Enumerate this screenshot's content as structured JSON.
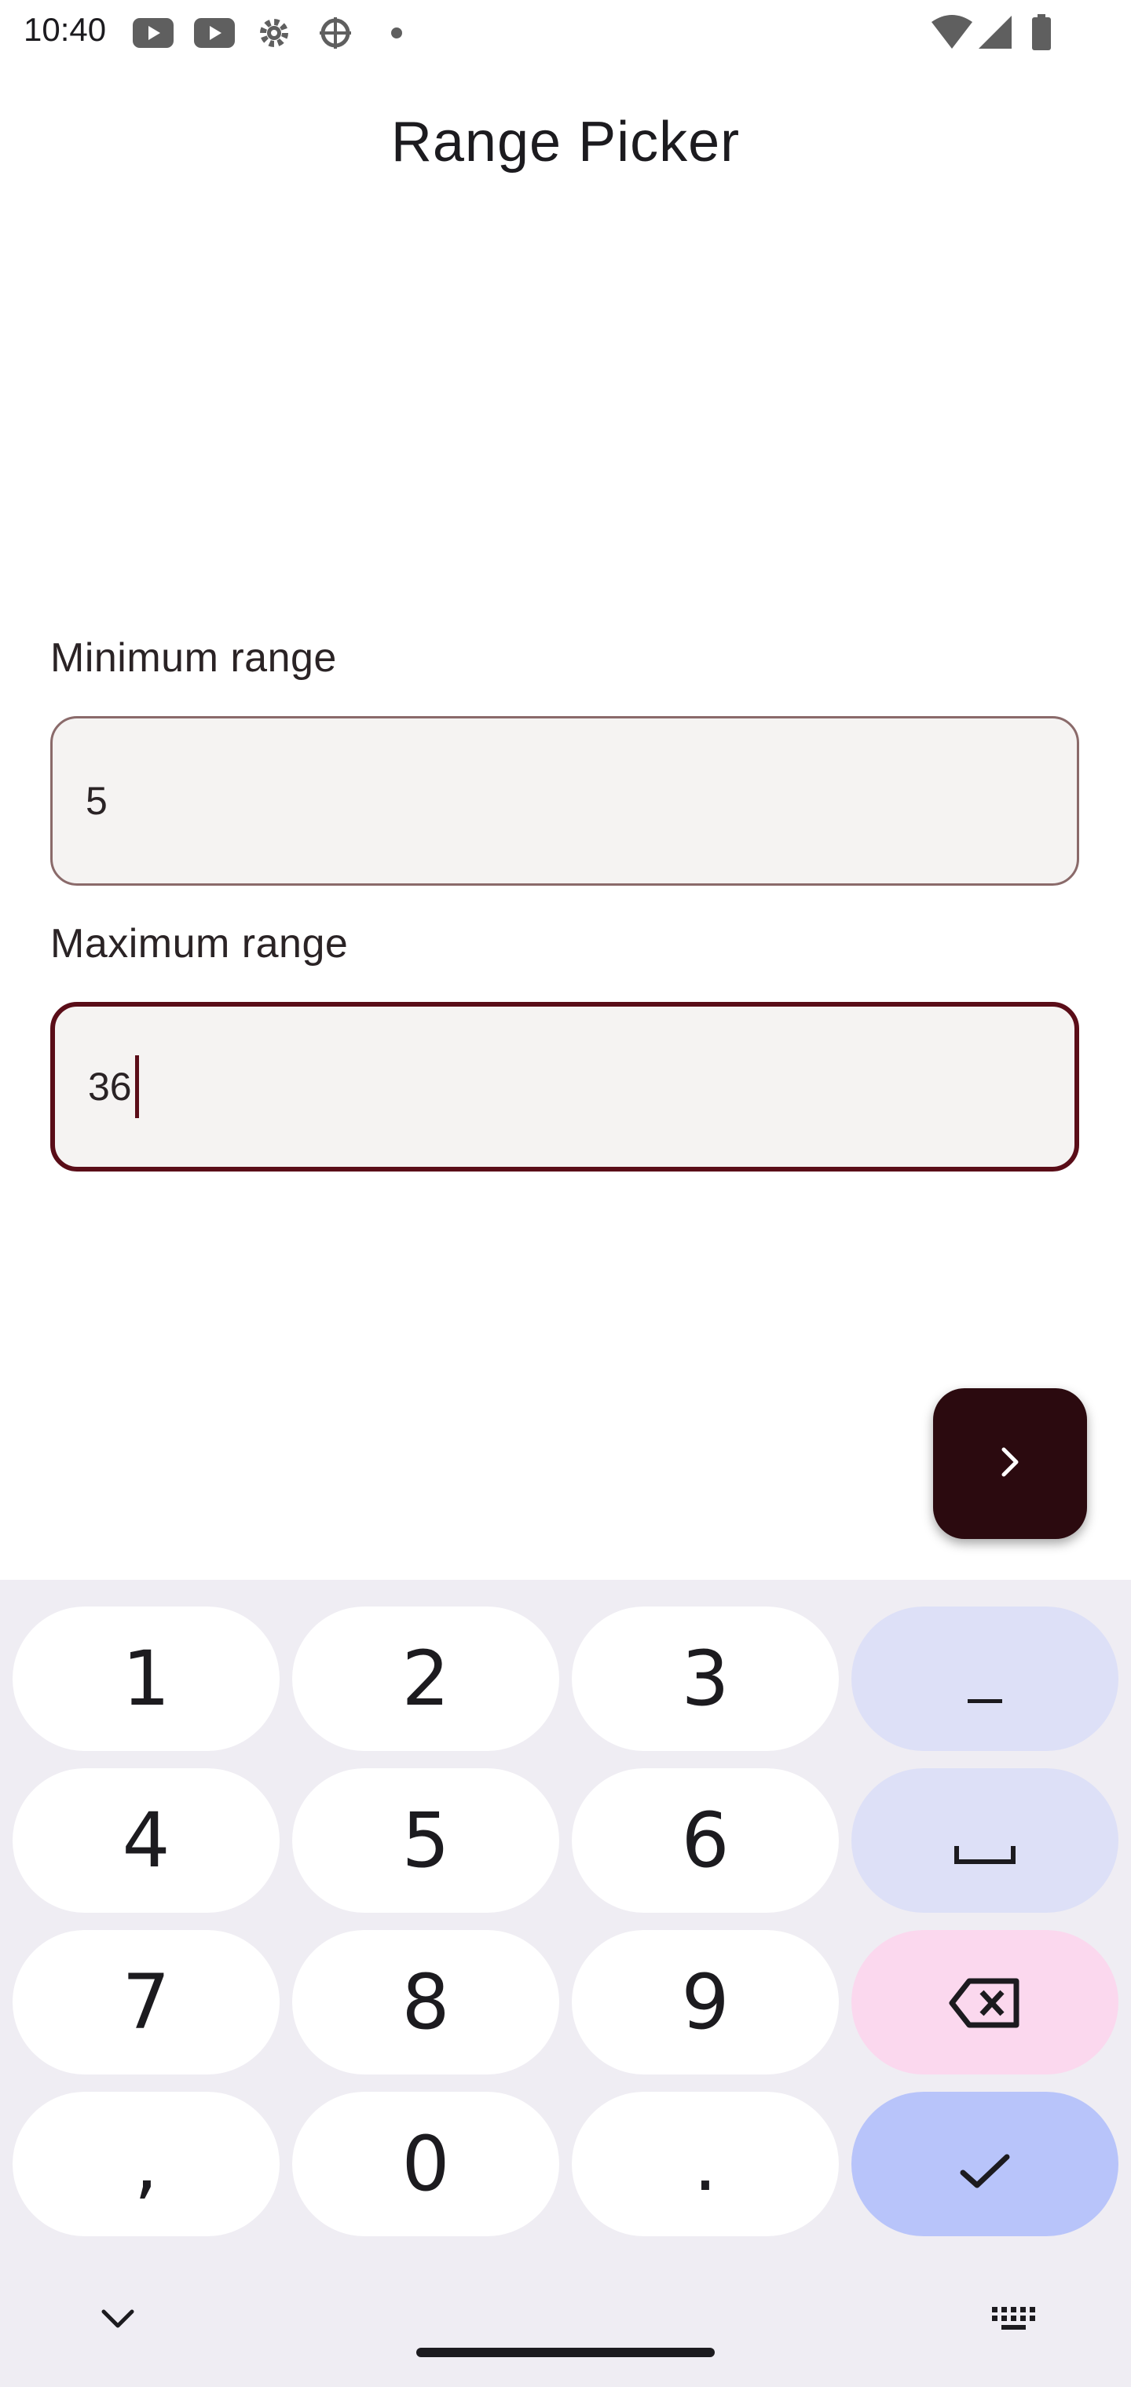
{
  "status_bar": {
    "time": "10:40",
    "left_icons": [
      "youtube-icon",
      "youtube-icon",
      "settings-icon",
      "debug-icon",
      "dot-icon"
    ],
    "right_icons": [
      "wifi-icon",
      "signal-icon",
      "battery-icon"
    ]
  },
  "page": {
    "title": "Range Picker"
  },
  "fields": {
    "min_label": "Minimum range",
    "min_value": "5",
    "max_label": "Maximum range",
    "max_value": "36"
  },
  "fab": {
    "icon": "chevron-right-icon"
  },
  "keyboard": {
    "rows": [
      [
        "1",
        "2",
        "3",
        "–"
      ],
      [
        "4",
        "5",
        "6",
        "␣"
      ],
      [
        "7",
        "8",
        "9",
        "⌫"
      ],
      [
        ",",
        "0",
        ".",
        "✓"
      ]
    ],
    "keys": {
      "k1": "1",
      "k2": "2",
      "k3": "3",
      "k4": "4",
      "k5": "5",
      "k6": "6",
      "k7": "7",
      "k8": "8",
      "k9": "9",
      "comma": ",",
      "k0": "0",
      "period": ".",
      "minus": "–"
    }
  },
  "colors": {
    "accent": "#5a0d18",
    "fab_bg": "#2b0a0f",
    "field_bg": "#f5f3f2",
    "keyboard_bg": "#efedf3",
    "fn_key": "#dde0f7",
    "delete_key": "#fbd8ee",
    "enter_key": "#b8c4fa"
  }
}
